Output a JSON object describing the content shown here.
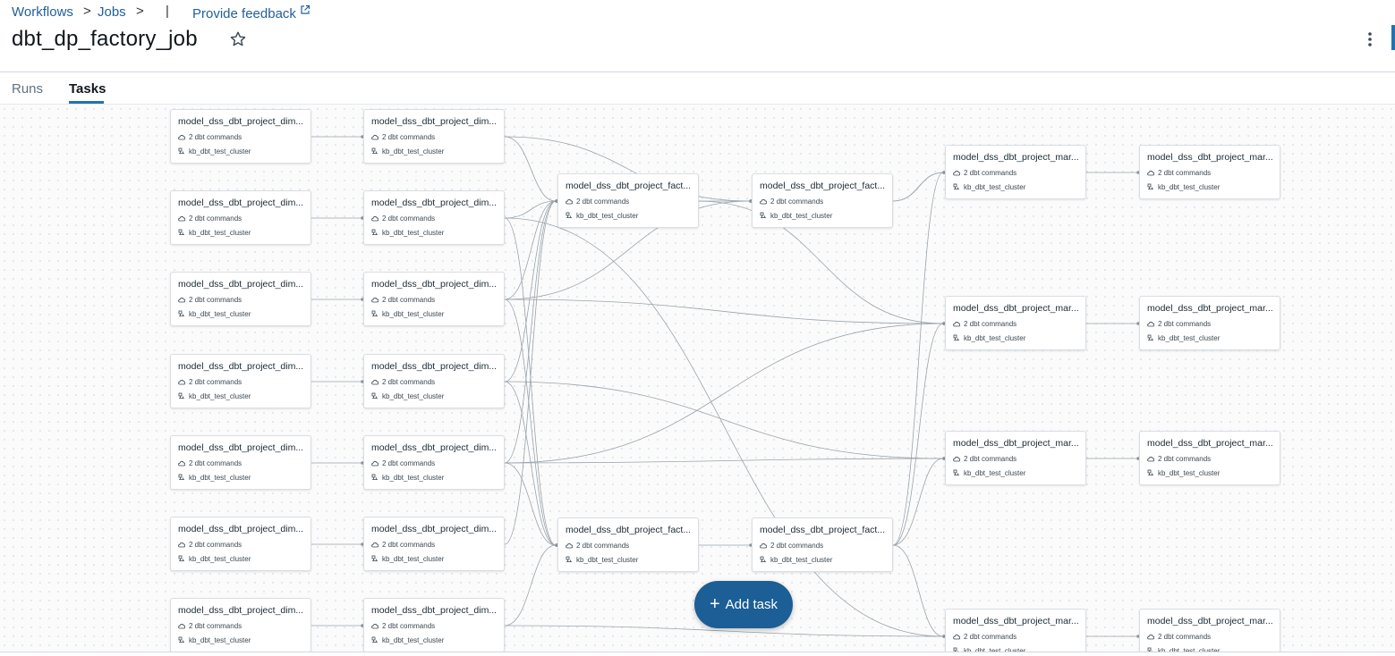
{
  "breadcrumb": {
    "workflows": "Workflows",
    "jobs": "Jobs",
    "separator": ">",
    "divider": "|",
    "feedback": "Provide feedback",
    "feedback_icon": "external-link-icon"
  },
  "job": {
    "title": "dbt_dp_factory_job"
  },
  "tabs": [
    {
      "label": "Runs",
      "active": false
    },
    {
      "label": "Tasks",
      "active": true
    }
  ],
  "task_defaults": {
    "commands": "2 dbt commands",
    "cluster": "kb_dbt_test_cluster"
  },
  "tasks": [
    {
      "id": "d1a",
      "title": "model_dss_dbt_project_dim..."
    },
    {
      "id": "d1b",
      "title": "model_dss_dbt_project_dim..."
    },
    {
      "id": "d1c",
      "title": "model_dss_dbt_project_dim..."
    },
    {
      "id": "d1d",
      "title": "model_dss_dbt_project_dim..."
    },
    {
      "id": "d1e",
      "title": "model_dss_dbt_project_dim..."
    },
    {
      "id": "d1f",
      "title": "model_dss_dbt_project_dim..."
    },
    {
      "id": "d1g",
      "title": "model_dss_dbt_project_dim..."
    },
    {
      "id": "d2a",
      "title": "model_dss_dbt_project_dim..."
    },
    {
      "id": "d2b",
      "title": "model_dss_dbt_project_dim..."
    },
    {
      "id": "d2c",
      "title": "model_dss_dbt_project_dim..."
    },
    {
      "id": "d2d",
      "title": "model_dss_dbt_project_dim..."
    },
    {
      "id": "d2e",
      "title": "model_dss_dbt_project_dim..."
    },
    {
      "id": "d2f",
      "title": "model_dss_dbt_project_dim..."
    },
    {
      "id": "d2g",
      "title": "model_dss_dbt_project_dim..."
    },
    {
      "id": "f1a",
      "title": "model_dss_dbt_project_fact..."
    },
    {
      "id": "f1b",
      "title": "model_dss_dbt_project_fact..."
    },
    {
      "id": "f2a",
      "title": "model_dss_dbt_project_fact..."
    },
    {
      "id": "f2b",
      "title": "model_dss_dbt_project_fact..."
    },
    {
      "id": "m1a",
      "title": "model_dss_dbt_project_mar..."
    },
    {
      "id": "m1b",
      "title": "model_dss_dbt_project_mar..."
    },
    {
      "id": "m1c",
      "title": "model_dss_dbt_project_mar..."
    },
    {
      "id": "m1d",
      "title": "model_dss_dbt_project_mar..."
    },
    {
      "id": "m2a",
      "title": "model_dss_dbt_project_mar..."
    },
    {
      "id": "m2b",
      "title": "model_dss_dbt_project_mar..."
    },
    {
      "id": "m2c",
      "title": "model_dss_dbt_project_mar..."
    },
    {
      "id": "m2d",
      "title": "model_dss_dbt_project_mar..."
    }
  ],
  "edges": [
    [
      "d1a",
      "d2a"
    ],
    [
      "d1b",
      "d2b"
    ],
    [
      "d1c",
      "d2c"
    ],
    [
      "d1d",
      "d2d"
    ],
    [
      "d1e",
      "d2e"
    ],
    [
      "d1f",
      "d2f"
    ],
    [
      "d1g",
      "d2g"
    ],
    [
      "d2a",
      "f1a"
    ],
    [
      "d2b",
      "f1a"
    ],
    [
      "d2c",
      "f1a"
    ],
    [
      "d2d",
      "f1a"
    ],
    [
      "d2e",
      "f1a"
    ],
    [
      "d2f",
      "f1a"
    ],
    [
      "d2b",
      "f2a"
    ],
    [
      "d2c",
      "f2a"
    ],
    [
      "d2d",
      "f2a"
    ],
    [
      "d2e",
      "f2a"
    ],
    [
      "d2g",
      "f2a"
    ],
    [
      "d2a",
      "f1b"
    ],
    [
      "d2c",
      "f1b"
    ],
    [
      "d2b",
      "m1d"
    ],
    [
      "d2c",
      "m1b"
    ],
    [
      "d2d",
      "m1c"
    ],
    [
      "d2e",
      "m1c"
    ],
    [
      "d2e",
      "m1b"
    ],
    [
      "d2g",
      "m1d"
    ],
    [
      "f1a",
      "f1b"
    ],
    [
      "f2a",
      "f2b"
    ],
    [
      "f1a",
      "m1b"
    ],
    [
      "f1b",
      "m1a"
    ],
    [
      "f1b",
      "m1a"
    ],
    [
      "f2b",
      "m1a"
    ],
    [
      "f2b",
      "m1b"
    ],
    [
      "f2b",
      "m1c"
    ],
    [
      "f2b",
      "m1d"
    ],
    [
      "m1a",
      "m2a"
    ],
    [
      "m1b",
      "m2b"
    ],
    [
      "m1c",
      "m2c"
    ],
    [
      "m1d",
      "m2d"
    ]
  ],
  "buttons": {
    "add_task": "Add task"
  },
  "icons": {
    "star": "star-icon",
    "more": "kebab-menu-icon",
    "commands": "dbt-cloud-icon",
    "cluster": "cluster-icon"
  },
  "colors": {
    "accent": "#2272b4",
    "link": "#22609a",
    "add_button": "#1c5e96",
    "edge": "#9aa3ab"
  }
}
